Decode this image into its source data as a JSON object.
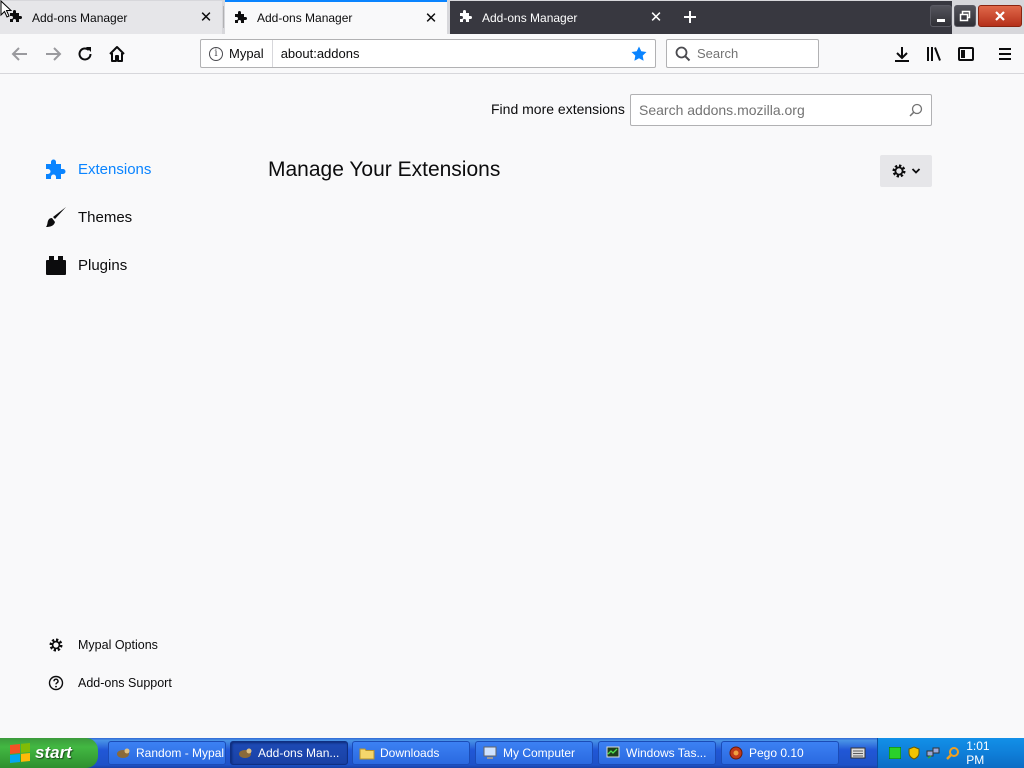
{
  "tabs": [
    {
      "title": "Add-ons Manager",
      "icon": "puzzle-icon",
      "state": "inactive"
    },
    {
      "title": "Add-ons Manager",
      "icon": "puzzle-icon",
      "state": "selected"
    },
    {
      "title": "Add-ons Manager",
      "icon": "puzzle-icon",
      "state": "inactive-dark"
    }
  ],
  "navbar": {
    "identity_label": "Mypal",
    "url": "about:addons",
    "search_placeholder": "Search"
  },
  "content": {
    "find_more_label": "Find more extensions",
    "amo_search_placeholder": "Search addons.mozilla.org",
    "page_title": "Manage Your Extensions",
    "categories": [
      {
        "label": "Extensions",
        "icon": "puzzle-icon",
        "selected": true
      },
      {
        "label": "Themes",
        "icon": "brush-icon",
        "selected": false
      },
      {
        "label": "Plugins",
        "icon": "plugin-block-icon",
        "selected": false
      }
    ],
    "footer_links": [
      {
        "label": "Mypal Options",
        "icon": "gear-icon"
      },
      {
        "label": "Add-ons Support",
        "icon": "help-icon"
      }
    ]
  },
  "taskbar": {
    "start_label": "start",
    "items": [
      {
        "label": "Random - Mypal",
        "icon": "mypal-icon",
        "active": false
      },
      {
        "label": "Add-ons Man...",
        "icon": "mypal-icon",
        "active": true
      },
      {
        "label": "Downloads",
        "icon": "folder-icon",
        "active": false
      },
      {
        "label": "My Computer",
        "icon": "computer-icon",
        "active": false
      },
      {
        "label": "Windows Tas...",
        "icon": "task-manager-icon",
        "active": false
      },
      {
        "label": "Pego 0.10",
        "icon": "pego-icon",
        "active": false
      }
    ],
    "clock": "1:01 PM"
  },
  "colors": {
    "accent": "#0a84ff",
    "tab_dark": "#383840",
    "taskbar_blue": "#245edb",
    "start_green": "#3c9a3c"
  }
}
